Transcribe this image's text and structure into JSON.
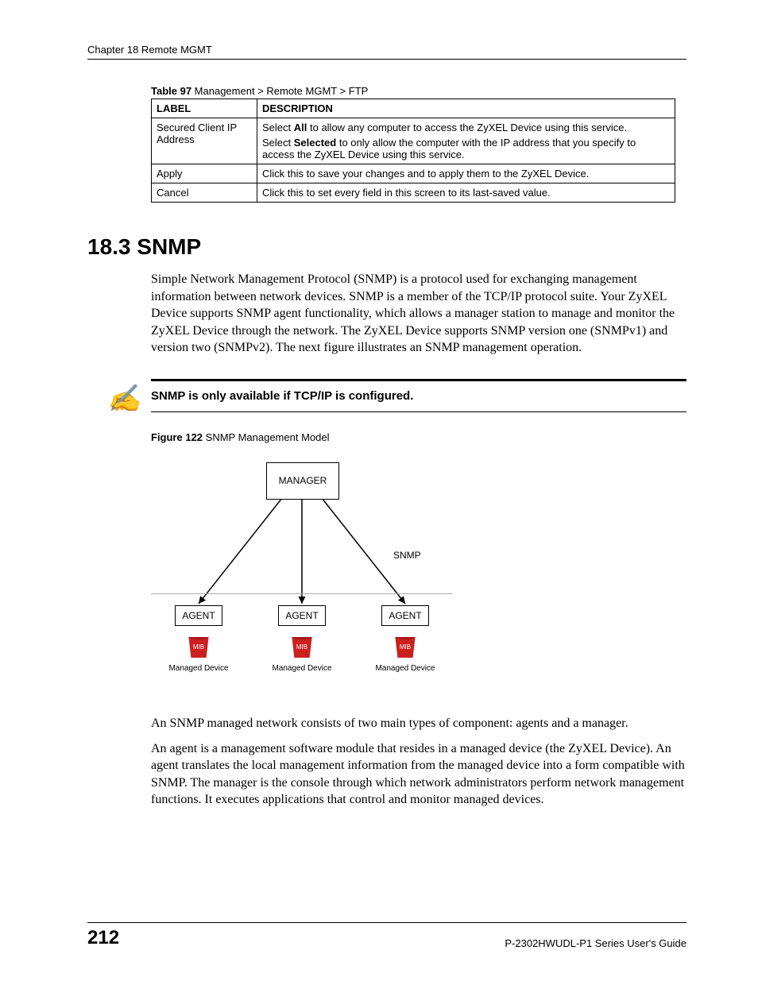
{
  "header": {
    "chapter": "Chapter 18 Remote MGMT"
  },
  "table": {
    "caption_bold": "Table 97",
    "caption_rest": "   Management > Remote MGMT > FTP",
    "headers": {
      "label": "LABEL",
      "description": "DESCRIPTION"
    },
    "rows": [
      {
        "label": "Secured Client IP Address",
        "desc_pre1": "Select ",
        "desc_b1": "All",
        "desc_post1": " to allow any computer to access the ZyXEL Device using this service.",
        "desc_pre2": "Select ",
        "desc_b2": "Selected",
        "desc_post2": " to only allow the computer with the IP address that you specify to access the ZyXEL Device using this service."
      },
      {
        "label": "Apply",
        "desc": "Click this to save your changes and to apply them to the ZyXEL Device."
      },
      {
        "label": "Cancel",
        "desc": "Click this to set every field in this screen to its last-saved value."
      }
    ]
  },
  "section": {
    "heading": "18.3  SNMP",
    "para1": "Simple Network Management Protocol (SNMP) is a protocol used for exchanging management information between network devices. SNMP is a member of the TCP/IP protocol suite. Your ZyXEL Device supports SNMP agent functionality, which allows a manager station to manage and monitor the ZyXEL Device through the network. The ZyXEL Device supports SNMP version one (SNMPv1) and version two (SNMPv2). The next figure illustrates an SNMP management operation."
  },
  "note": {
    "icon": "✍",
    "text": "SNMP is only available if TCP/IP is configured."
  },
  "figure": {
    "caption_bold": "Figure 122",
    "caption_rest": "   SNMP Management Model",
    "manager": "MANAGER",
    "snmp": "SNMP",
    "agent": "AGENT",
    "mib": "MIB",
    "managed": "Managed Device"
  },
  "body": {
    "para2": "An SNMP managed network consists of two main types of component: agents and a manager.",
    "para3": "An agent is a management software module that resides in a managed device (the ZyXEL Device). An agent translates the local management information from the managed device into a form compatible with SNMP. The manager is the console through which network administrators perform network management functions. It executes applications that control and monitor managed devices."
  },
  "footer": {
    "page": "212",
    "guide": "P-2302HWUDL-P1 Series User's Guide"
  }
}
